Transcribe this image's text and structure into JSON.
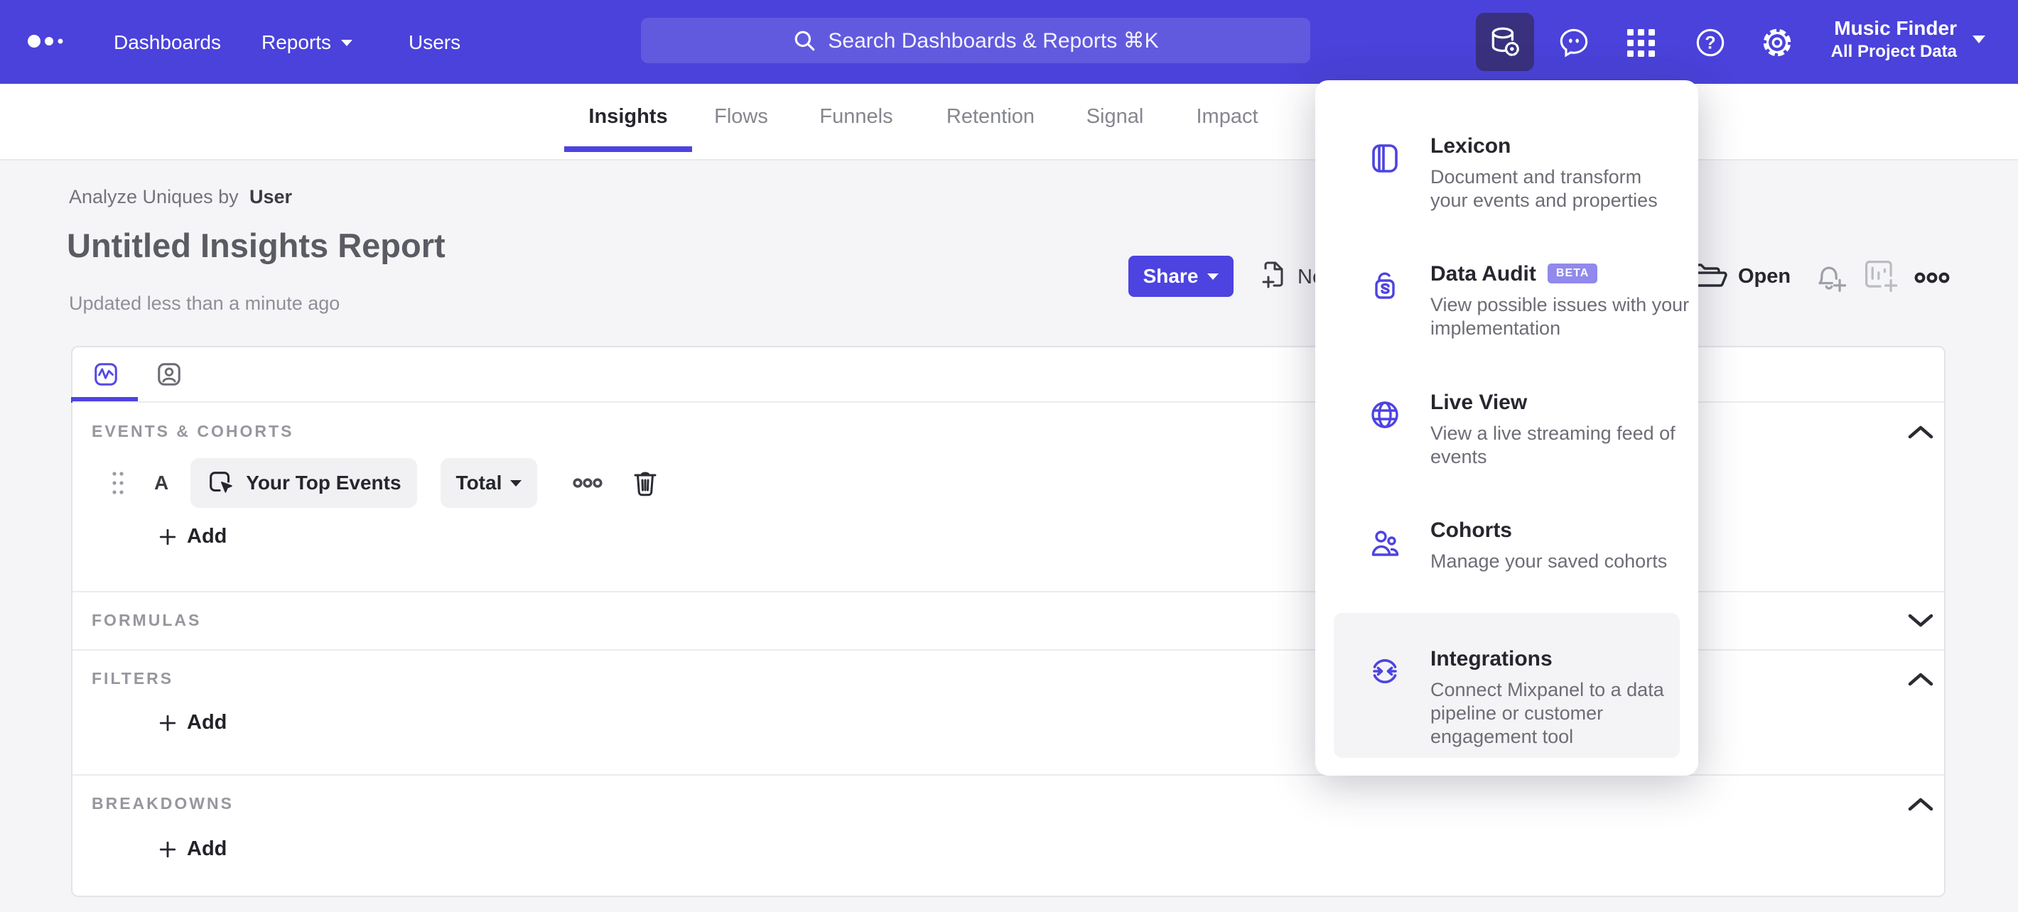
{
  "colors": {
    "nav_bg": "#4a42da",
    "accent": "#4d43e1",
    "active_icon_bg": "#39317e",
    "beta_badge_bg": "#9189ec",
    "page_bg": "#f5f5f7",
    "menu_highlight_bg": "#f4f4f6"
  },
  "nav": {
    "logo_icon": "mixpanel-dots-logo",
    "items": [
      "Dashboards",
      "Reports",
      "Users"
    ],
    "search_placeholder": "Search Dashboards & Reports ⌘K",
    "icon_names": [
      "data-tools-icon",
      "feedback-bubble-icon",
      "apps-grid-icon",
      "help-icon",
      "settings-gear-icon"
    ],
    "project_name": "Music Finder",
    "project_scope": "All Project Data"
  },
  "tabs": {
    "items": [
      "Insights",
      "Flows",
      "Funnels",
      "Retention",
      "Signal",
      "Impact"
    ],
    "active": "Insights"
  },
  "report": {
    "breadcrumb_prefix": "Analyze Uniques by",
    "breadcrumb_entity": "User",
    "title": "Untitled Insights Report",
    "updated": "Updated less than a minute ago"
  },
  "toolbar": {
    "share": "Share",
    "new_partial": "Ne",
    "open": "Open",
    "icon_names": [
      "new-report-icon",
      "open-folder-icon",
      "bell-plus-icon",
      "chart-plus-icon",
      "more-icon"
    ]
  },
  "builder": {
    "tab_icons": [
      "insights-chart-icon",
      "profile-icon"
    ],
    "sections": [
      {
        "label": "EVENTS & COHORTS",
        "chevron": "up"
      },
      {
        "label": "FORMULAS",
        "chevron": "down"
      },
      {
        "label": "FILTERS",
        "chevron": "up"
      },
      {
        "label": "BREAKDOWNS",
        "chevron": "up"
      }
    ],
    "row": {
      "letter": "A",
      "event": "Your Top Events",
      "event_icon": "event-click-icon",
      "aggregation": "Total",
      "actions": [
        "more-icon",
        "trash-icon"
      ]
    },
    "add": "Add"
  },
  "menu": {
    "items": [
      {
        "title": "Lexicon",
        "icon": "lexicon-book-icon",
        "description": "Document and transform\nyour events and properties"
      },
      {
        "title": "Data Audit",
        "badge": "BETA",
        "icon": "data-audit-icon",
        "description": "View possible issues with your\nimplementation"
      },
      {
        "title": "Live View",
        "icon": "globe-icon",
        "description": "View a live streaming feed of\nevents"
      },
      {
        "title": "Cohorts",
        "icon": "cohorts-users-icon",
        "description": "Manage your saved cohorts"
      },
      {
        "title": "Integrations",
        "icon": "integrations-sync-icon",
        "description": "Connect Mixpanel to a data\npipeline or customer\nengagement tool",
        "highlighted": true
      }
    ]
  }
}
